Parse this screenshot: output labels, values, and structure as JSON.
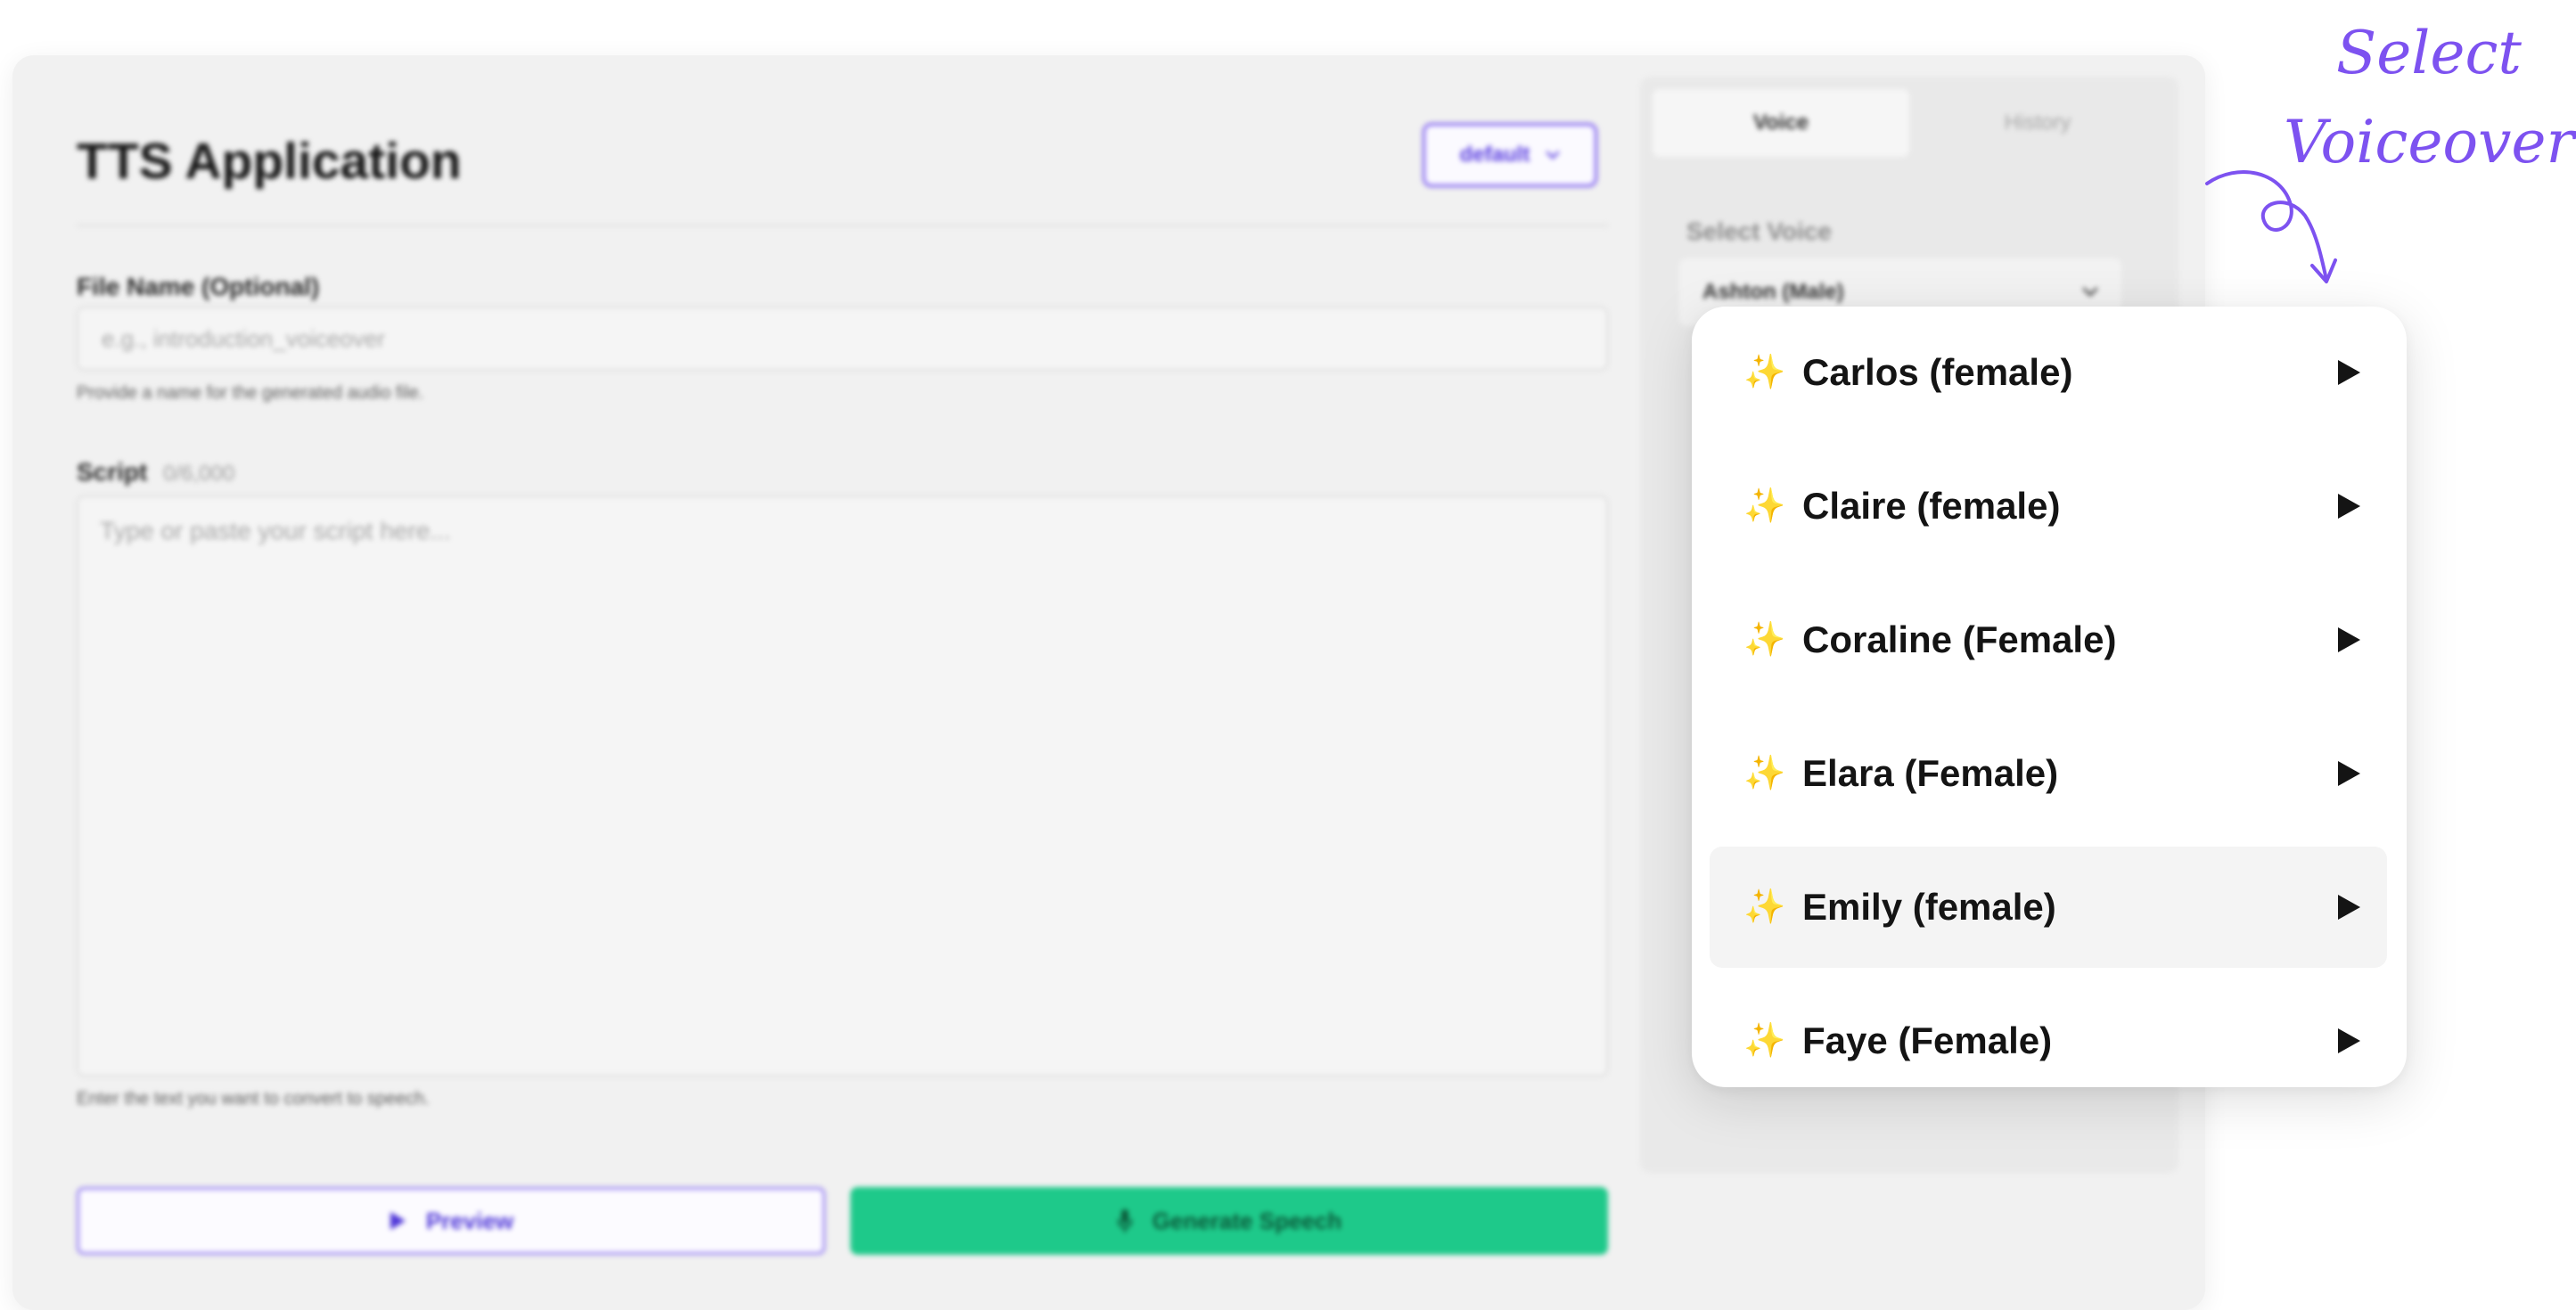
{
  "app": {
    "title": "TTS Application",
    "profile_select": "default"
  },
  "form": {
    "file_name_label": "File Name (Optional)",
    "file_name_placeholder": "e.g., introduction_voiceover",
    "file_name_help": "Provide a name for the generated audio file.",
    "script_label": "Script",
    "script_count": "0/6,000",
    "script_placeholder": "Type or paste your script here...",
    "script_help": "Enter the text you want to convert to speech.",
    "preview_label": "Preview",
    "generate_label": "Generate Speech"
  },
  "side_panel": {
    "tabs": [
      {
        "label": "Voice",
        "active": true
      },
      {
        "label": "History",
        "active": false
      }
    ],
    "select_voice_label": "Select Voice",
    "selected_voice": "Ashton (Male)"
  },
  "voice_dropdown": {
    "options": [
      {
        "label": "Carlos (female)",
        "highlighted": false
      },
      {
        "label": "Claire (female)",
        "highlighted": false
      },
      {
        "label": "Coraline (Female)",
        "highlighted": false
      },
      {
        "label": "Elara (Female)",
        "highlighted": false
      },
      {
        "label": "Emily (female)",
        "highlighted": true
      },
      {
        "label": "Faye (Female)",
        "highlighted": false
      }
    ]
  },
  "callout": {
    "line1": "Select",
    "line2": "Voiceover",
    "color": "#7d52f0"
  },
  "colors": {
    "accent": "#6b4ff0",
    "generate_button": "#1ec98a",
    "sparkle": "#f3b52a"
  },
  "icons": {
    "option_icon": "sparkle-icon",
    "option_action": "play-icon",
    "select_caret": "chevron-down-icon",
    "generate_icon": "microphone-icon"
  }
}
